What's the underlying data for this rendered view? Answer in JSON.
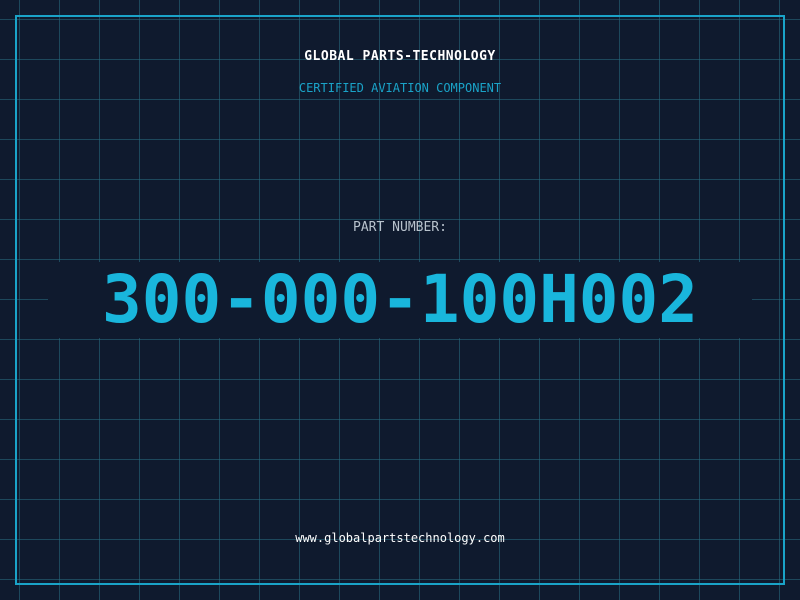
{
  "header": {
    "brand": "GLOBAL PARTS-TECHNOLOGY",
    "tagline": "CERTIFIED AVIATION COMPONENT"
  },
  "part": {
    "label": "PART NUMBER:",
    "number": "300-000-100H002"
  },
  "footer": {
    "url": "www.globalpartstechnology.com"
  },
  "colors": {
    "background": "#0f1a2e",
    "grid": "#286e82",
    "accent": "#1aa3c8",
    "part_number": "#19b6dc",
    "text": "#ffffff",
    "label": "#b8c2cc"
  }
}
